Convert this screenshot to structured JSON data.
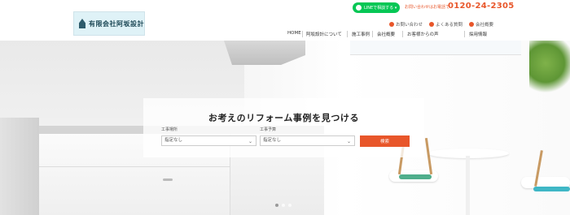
{
  "header": {
    "logo_text": "有限会社阿坂設計",
    "line_button_label": "LINEで相談する ▾",
    "tel_note": "お問い合わせはお電話で",
    "tel_number": "0120-24-2305",
    "utility_links": [
      "お問い合わせ",
      "よくある質問",
      "会社概要"
    ],
    "nav_items": [
      "HOME",
      "阿坂設計について",
      "施工事例",
      "会社概要",
      "お客様からの声",
      "採用情報"
    ]
  },
  "search": {
    "title": "お考えのリフォーム事例を見つける",
    "field1_label": "工事場所",
    "field1_value": "指定なし",
    "field2_label": "工事予算",
    "field2_value": "指定なし",
    "button_label": "検索"
  },
  "slider": {
    "dot_count": 3,
    "active_index": 0
  },
  "colors": {
    "accent": "#e8562a",
    "line_green": "#06c755"
  }
}
